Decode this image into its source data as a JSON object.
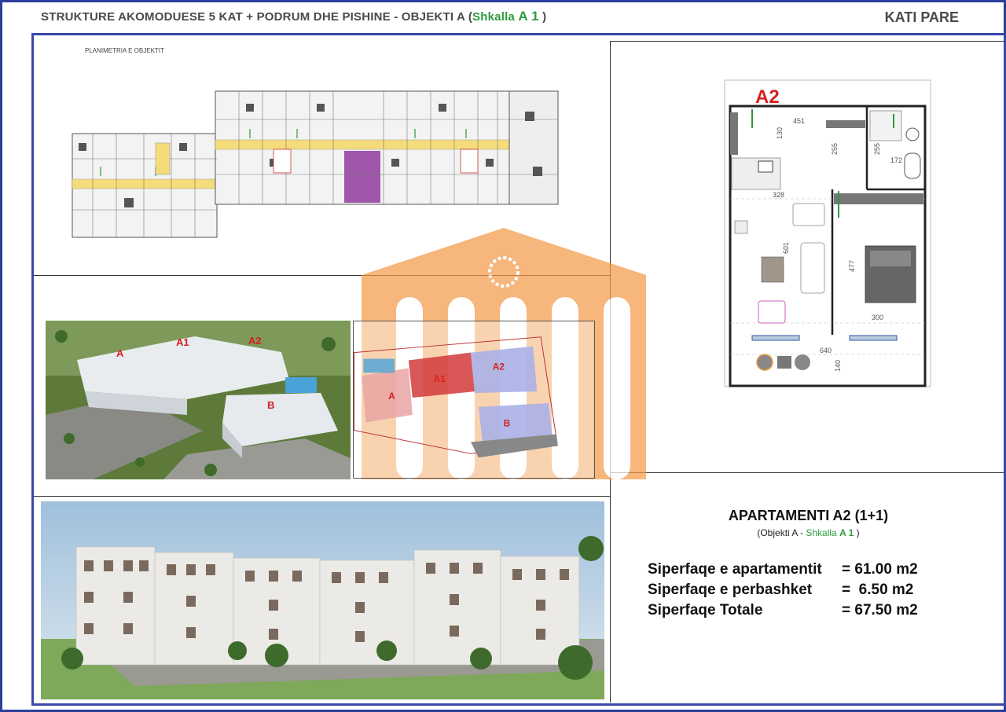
{
  "header": {
    "title_main": "STRUKTURE AKOMODUESE 5 KAT + PODRUM DHE PISHINE   -  OBJEKTI A (",
    "title_shkalla": "Shkalla ",
    "title_a1": "A 1",
    "title_close": " )",
    "floor_label": "KATI PARE"
  },
  "site_plan": {
    "label": "PLANIMETRIA E OBJEKTIT"
  },
  "aerial": {
    "labels": [
      "A",
      "A1",
      "A2",
      "B"
    ]
  },
  "site_map": {
    "labels": [
      "A",
      "A1",
      "A2",
      "B"
    ]
  },
  "unit_plan": {
    "unit_tag": "A2",
    "dimensions": [
      "451",
      "130",
      "255",
      "255",
      "172",
      "328",
      "601",
      "477",
      "300",
      "640",
      "140"
    ]
  },
  "apartment": {
    "title": "APARTAMENTI A2 (1+1)",
    "sub_prefix": "(Objekti A - ",
    "sub_shkalla": "Shkalla ",
    "sub_a1": "A 1",
    "sub_suffix": " )",
    "areas": [
      {
        "label": "Siperfaqe e apartamentit",
        "value": "= 61.00 m2"
      },
      {
        "label": "Siperfaqe e perbashket",
        "value": "=  6.50 m2"
      },
      {
        "label": "Siperfaqe Totale",
        "value": "= 67.50 m2"
      }
    ]
  },
  "colors": {
    "frame": "#3947a8",
    "watermark": "#f39a4a",
    "accent_green": "#2e9b3e",
    "tag_red": "#d42020"
  },
  "icons": [
    "building-watermark-icon",
    "floor-plan-drawing",
    "aerial-render-image",
    "site-map-image",
    "street-render-image",
    "unit-plan-drawing"
  ]
}
